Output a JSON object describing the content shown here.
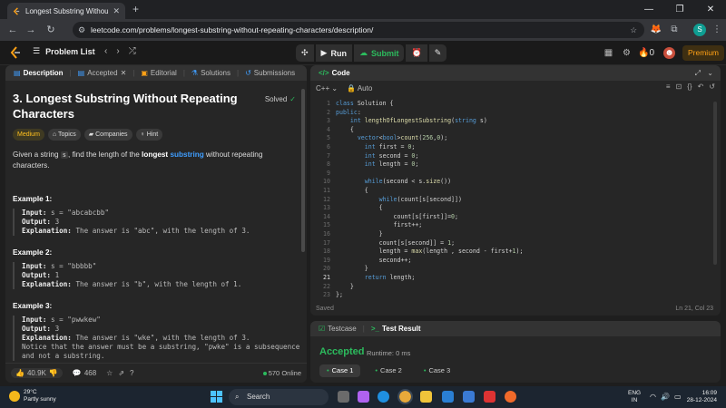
{
  "browser": {
    "tab_title": "Longest Substring Without Re...",
    "url": "leetcode.com/problems/longest-substring-without-repeating-characters/description/",
    "profile_initial": "S"
  },
  "lc_top": {
    "problem_list": "Problem List",
    "run": "Run",
    "submit": "Submit",
    "streak": "0",
    "premium": "Premium"
  },
  "left": {
    "tabs": [
      "Description",
      "Accepted",
      "Editorial",
      "Solutions",
      "Submissions"
    ],
    "title": "3. Longest Substring Without Repeating Characters",
    "solved": "Solved",
    "tags": [
      "Medium",
      "Topics",
      "Companies",
      "Hint"
    ],
    "desc_pre": "Given a string ",
    "desc_code": "s",
    "desc_mid": ", find the length of the ",
    "desc_bold": "longest",
    "desc_link": "substring",
    "desc_post": " without repeating characters.",
    "examples": [
      {
        "title": "Example 1:",
        "input": "s = \"abcabcbb\"",
        "output": "3",
        "explanation": "The answer is \"abc\", with the length of 3."
      },
      {
        "title": "Example 2:",
        "input": "s = \"bbbbb\"",
        "output": "1",
        "explanation": "The answer is \"b\", with the length of 1."
      },
      {
        "title": "Example 3:",
        "input": "s = \"pwwkew\"",
        "output": "3",
        "explanation": "The answer is \"wke\", with the length of 3.",
        "note1": "Notice that the answer must be a substring, \"pwke\" is a subsequence",
        "note2": "and not a substring."
      }
    ],
    "labels": {
      "input": "Input:",
      "output": "Output:",
      "explanation": "Explanation:"
    },
    "likes": "40.9K",
    "comments": "468",
    "online": "570 Online"
  },
  "code": {
    "tab": "Code",
    "language": "C++",
    "mode": "Auto",
    "status": "Saved",
    "position": "Ln 21, Col 23",
    "current_line": 21,
    "lines": [
      "class Solution {",
      "public:",
      "    int lengthOfLongestSubstring(string s)",
      "    {",
      "      vector<bool>count(256,0);",
      "        int first = 0;",
      "        int second = 0;",
      "        int length = 0;",
      "",
      "        while(second < s.size())",
      "        {",
      "            while(count[s[second]])",
      "            {",
      "                count[s[first]]=0;",
      "                first++;",
      "            }",
      "            count[s[second]] = 1;",
      "            length = max(length , second - first+1);",
      "            second++;",
      "        }",
      "        return length;",
      "    }",
      "};"
    ]
  },
  "test": {
    "tabs": [
      "Testcase",
      "Test Result"
    ],
    "result": "Accepted",
    "runtime": "Runtime: 0 ms",
    "cases": [
      "Case 1",
      "Case 2",
      "Case 3"
    ]
  },
  "taskbar": {
    "temp": "29°C",
    "weather": "Partly sunny",
    "search": "Search",
    "lang1": "ENG",
    "lang2": "IN",
    "time": "16:09",
    "date": "28-12-2024"
  }
}
